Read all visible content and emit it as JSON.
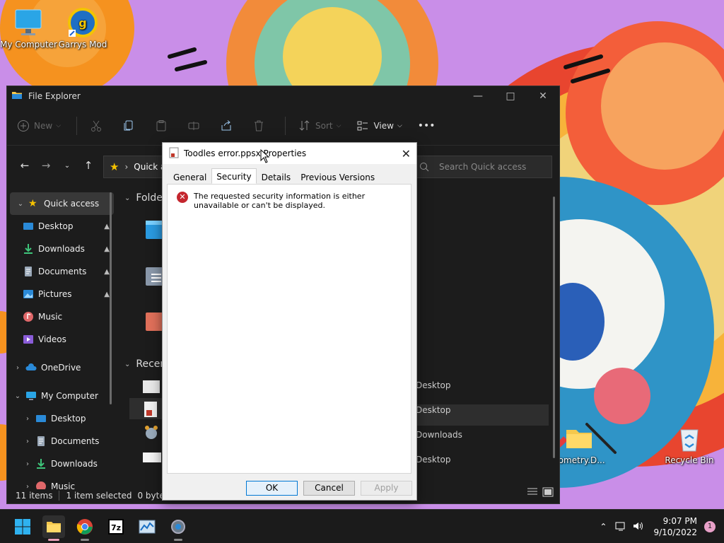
{
  "desktop": {
    "icons": [
      {
        "label": "My Computer",
        "icon": "monitor-icon"
      },
      {
        "label": "Garrys Mod",
        "icon": "garrys-mod-icon"
      },
      {
        "label": "eometry.D...",
        "icon": "folder-icon"
      },
      {
        "label": "Recycle Bin",
        "icon": "recycle-bin-icon"
      }
    ]
  },
  "explorer": {
    "title": "File Explorer",
    "toolbar": {
      "new_label": "New",
      "sort_label": "Sort",
      "view_label": "View",
      "more_label": "•••"
    },
    "address": {
      "path_label": "Quick a",
      "search_placeholder": "Search Quick access"
    },
    "nav": {
      "quick_access": "Quick access",
      "items": [
        {
          "label": "Desktop",
          "pin": "📌"
        },
        {
          "label": "Downloads",
          "pin": "📌"
        },
        {
          "label": "Documents",
          "pin": "📌"
        },
        {
          "label": "Pictures",
          "pin": "📌"
        },
        {
          "label": "Music"
        },
        {
          "label": "Videos"
        }
      ],
      "onedrive": "OneDrive",
      "my_computer": "My Computer",
      "computer_items": [
        "Desktop",
        "Documents",
        "Downloads",
        "Music"
      ]
    },
    "content": {
      "folders_header": "Folder",
      "recent_header": "Recen",
      "recent_locations": [
        "Desktop",
        "Desktop",
        "Downloads",
        "Desktop"
      ]
    },
    "status": {
      "items": "11 items",
      "selected": "1 item selected",
      "size": "0 bytes"
    }
  },
  "dialog": {
    "title": "Toodles error.ppsx Properties",
    "tabs": [
      "General",
      "Security",
      "Details",
      "Previous Versions"
    ],
    "active_tab": "Security",
    "error_message": "The requested security information is either unavailable or can't be displayed.",
    "buttons": {
      "ok": "OK",
      "cancel": "Cancel",
      "apply": "Apply"
    }
  },
  "taskbar": {
    "time": "9:07 PM",
    "date": "9/10/2022",
    "notification_count": "1",
    "apps": [
      "start-icon",
      "file-explorer-icon",
      "chrome-icon",
      "seven-zip-icon",
      "task-manager-icon",
      "settings-icon"
    ],
    "seven_zip_label": "7z"
  }
}
